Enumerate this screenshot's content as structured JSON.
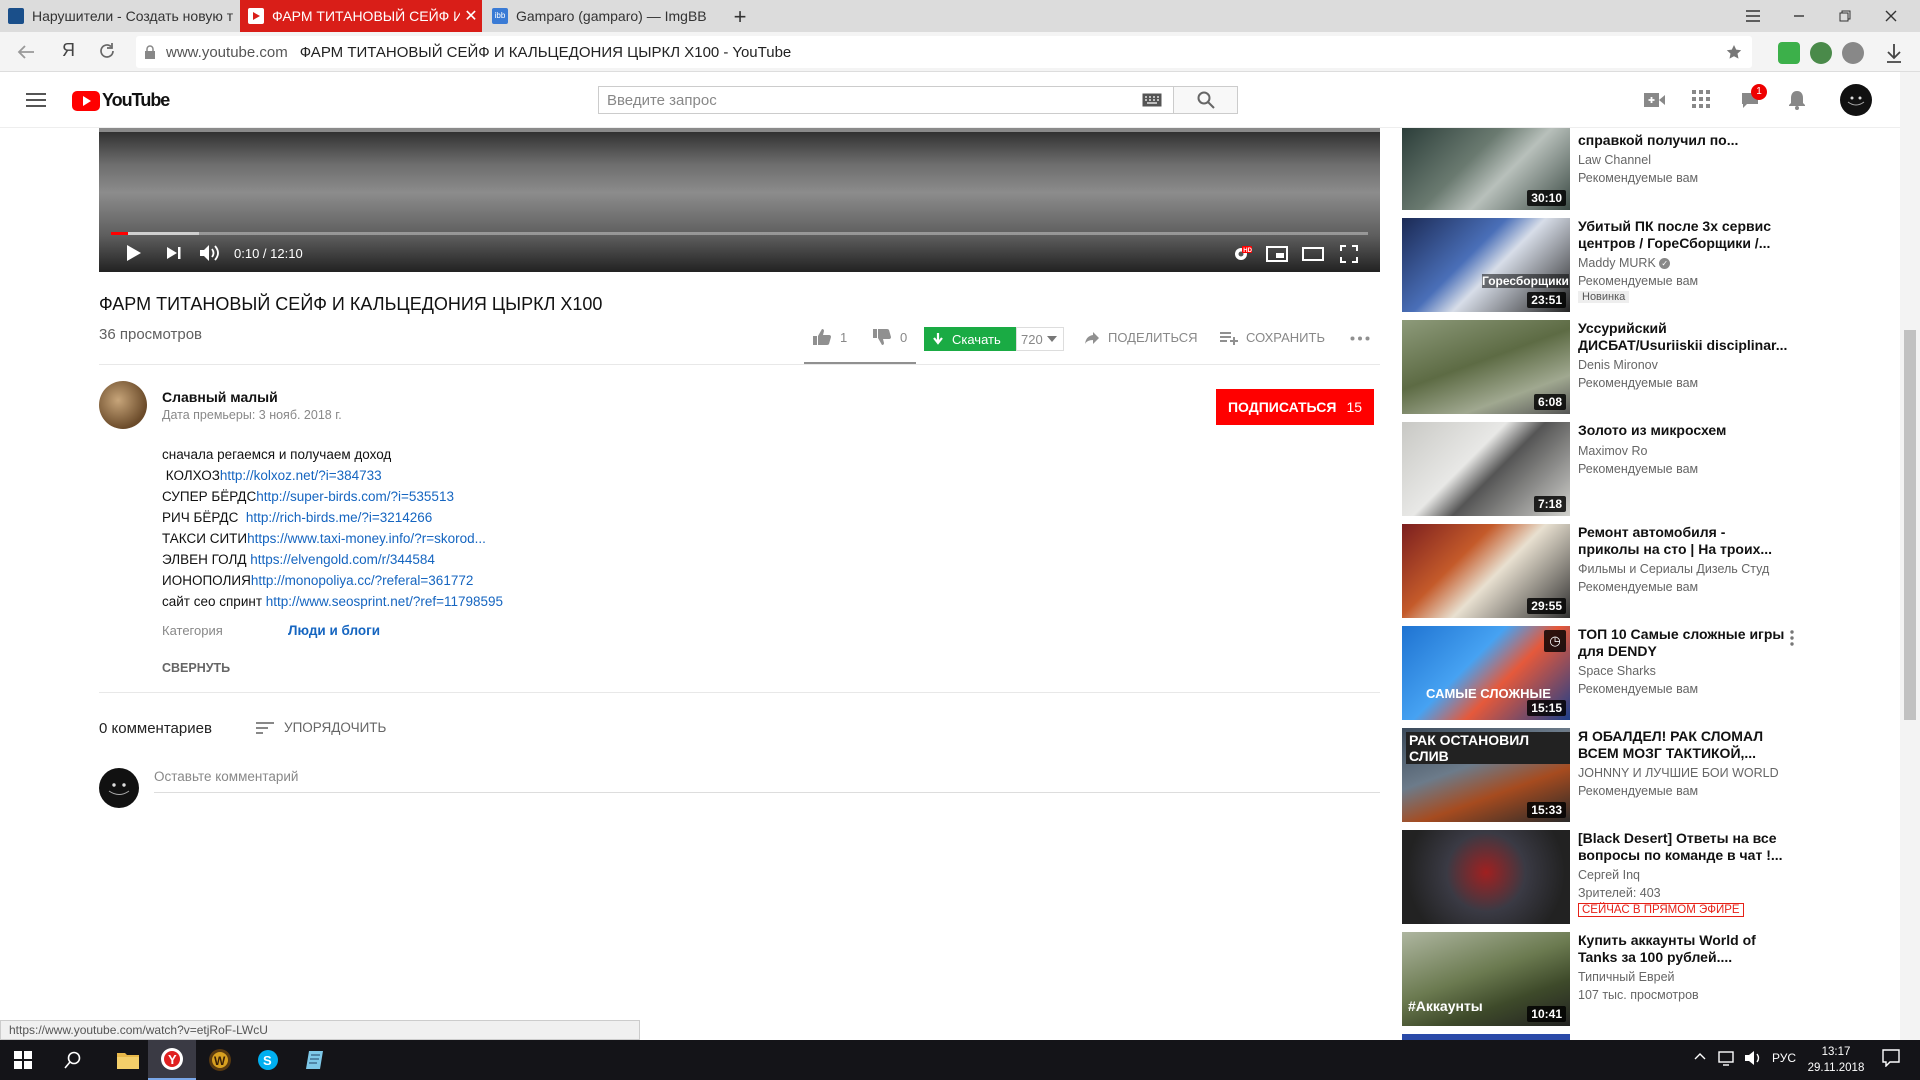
{
  "browser": {
    "tabs": [
      {
        "title": "Нарушители - Создать новую т",
        "favicon_color": "#1a4f8a"
      },
      {
        "title": "ФАРМ ТИТАНОВЫЙ СЕЙФ И",
        "favicon_color": "#ffffff"
      },
      {
        "title": "Gamparo (gamparo) — ImgBB",
        "favicon_color": "#3a7bd5"
      }
    ],
    "new_tab": "+",
    "address": {
      "domain": "www.youtube.com",
      "page_title": "ФАРМ ТИТАНОВЫЙ СЕЙФ И КАЛЬЦЕДОНИЯ ЦЫРКЛ X100 - YouTube"
    },
    "yandex_letter": "Я",
    "status_url": "https://www.youtube.com/watch?v=etjRoF-LWcU"
  },
  "youtube": {
    "logo_text": "YouTube",
    "search_placeholder": "Введите запрос",
    "notification_count": "1",
    "accent": "#ff0000"
  },
  "player": {
    "time": "0:10 / 12:10",
    "progress_played": 0.0137,
    "progress_buffered": 0.07
  },
  "video": {
    "title": "ФАРМ ТИТАНОВЫЙ СЕЙФ И КАЛЬЦЕДОНИЯ ЦЫРКЛ X100",
    "views": "36 просмотров",
    "likes": "1",
    "dislikes": "0",
    "download_label": "Скачать",
    "quality": "720",
    "share_label": "ПОДЕЛИТЬСЯ",
    "save_label": "СОХРАНИТЬ",
    "channel": "Славный малый",
    "premiere_date": "Дата премьеры: 3 нояб. 2018 г.",
    "subscribe_label": "ПОДПИСАТЬСЯ",
    "subscribers": "15",
    "description": {
      "intro": "сначала регаемся и получаем доход",
      "lines": [
        {
          "label": " КОЛХОЗ",
          "url": "http://kolxoz.net/?i=384733"
        },
        {
          "label": "СУПЕР БЁРДС",
          "url": "http://super-birds.com/?i=535513"
        },
        {
          "label": "РИЧ БЁРДС  ",
          "url": "http://rich-birds.me/?i=3214266"
        },
        {
          "label": "ТАКСИ СИТИ",
          "url": "https://www.taxi-money.info/?r=skorod..."
        },
        {
          "label": "ЭЛВЕН ГОЛД ",
          "url": "https://elvengold.com/r/344584"
        },
        {
          "label": "ИОНОПОЛИЯ",
          "url": "http://monopoliya.cc/?referal=361772"
        },
        {
          "label": "сайт сео спринт ",
          "url": "http://www.seosprint.net/?ref=11798595"
        }
      ]
    },
    "category_label": "Категория",
    "category_value": "Люди и блоги",
    "collapse_label": "СВЕРНУТЬ",
    "comments_count": "0 комментариев",
    "sort_label": "УПОРЯДОЧИТЬ",
    "comment_placeholder": "Оставьте комментарий"
  },
  "sidebar": {
    "partial_top": {
      "title": "справкой получил по...",
      "channel": "Law Channel",
      "info": "Рекомендуемые вам",
      "duration": "30:10"
    },
    "items": [
      {
        "title": "Убитый ПК после 3х сервис центров / ГореСборщики /...",
        "channel": "Maddy MURK",
        "verified": true,
        "info": "Рекомендуемые вам",
        "badge": "Новинка",
        "duration": "23:51",
        "thumb_text": "Горесборщики"
      },
      {
        "title": "Уссурийский ДИСБАТ/Usuriiskii disciplinar...",
        "channel": "Denis Mironov",
        "info": "Рекомендуемые вам",
        "duration": "6:08"
      },
      {
        "title": "Золото из микросхем",
        "channel": "Maximov Ro",
        "info": "Рекомендуемые вам",
        "duration": "7:18"
      },
      {
        "title": "Ремонт автомобиля - приколы на сто | На троих...",
        "channel": "Фильмы и Сериалы Дизель Студ",
        "info": "Рекомендуемые вам",
        "duration": "29:55"
      },
      {
        "title": "ТОП 10 Самые сложные игры для DENDY",
        "channel": "Space Sharks",
        "info": "Рекомендуемые вам",
        "duration": "15:15",
        "thumb_text": "САМЫЕ СЛОЖНЫЕ"
      },
      {
        "title": "Я ОБАЛДЕЛ! РАК СЛОМАЛ ВСЕМ МОЗГ ТАКТИКОЙ,...",
        "channel": "JOHNNY И ЛУЧШИЕ БОИ WORLD",
        "info": "Рекомендуемые вам",
        "duration": "15:33",
        "thumb_text": "РАК ОСТАНОВИЛ СЛИВ"
      },
      {
        "title": "[Black Desert] Ответы на все вопросы по команде в чат !...",
        "channel": "Сергей Inq",
        "info": "Зрителей: 403",
        "live": "СЕЙЧАС В ПРЯМОМ ЭФИРЕ"
      },
      {
        "title": "Купить аккаунты World of Tanks за 100 рублей....",
        "channel": "Типичный Еврей",
        "info": "107 тыс. просмотров",
        "duration": "10:41",
        "thumb_text": "#Аккаунты"
      }
    ]
  },
  "taskbar": {
    "lang": "РУС",
    "time": "13:17",
    "date": "29.11.2018"
  }
}
